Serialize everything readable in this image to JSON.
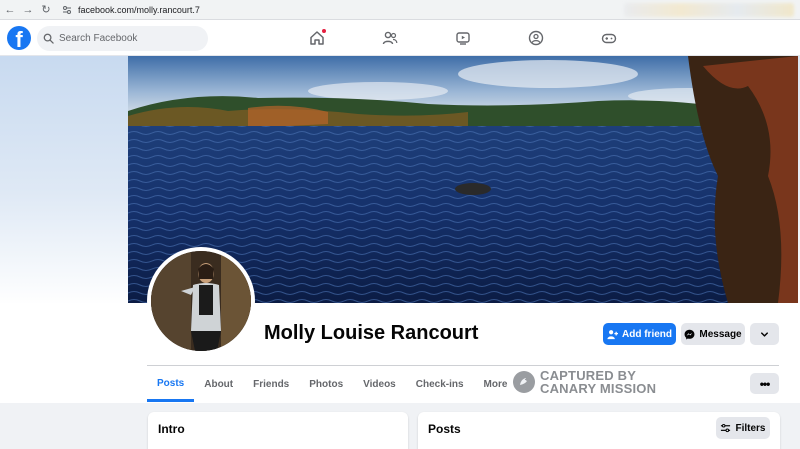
{
  "browser": {
    "url": "facebook.com/molly.rancourt.7"
  },
  "header": {
    "logo": "f",
    "search_placeholder": "Search Facebook",
    "nav_icons": [
      "home-icon",
      "friends-icon",
      "watch-icon",
      "groups-icon",
      "gaming-icon"
    ]
  },
  "profile": {
    "name": "Molly Louise Rancourt",
    "add_friend_label": "Add friend",
    "message_label": "Message"
  },
  "tabs": [
    {
      "label": "Posts"
    },
    {
      "label": "About"
    },
    {
      "label": "Friends"
    },
    {
      "label": "Photos"
    },
    {
      "label": "Videos"
    },
    {
      "label": "Check-ins"
    },
    {
      "label": "More"
    }
  ],
  "watermark": {
    "line1": "CAPTURED BY",
    "line2": "CANARY MISSION"
  },
  "more_menu_label": "•••",
  "intro": {
    "title": "Intro"
  },
  "posts": {
    "title": "Posts",
    "filters_label": "Filters"
  },
  "colors": {
    "brand": "#1877f2",
    "notification": "#e41e3f"
  }
}
